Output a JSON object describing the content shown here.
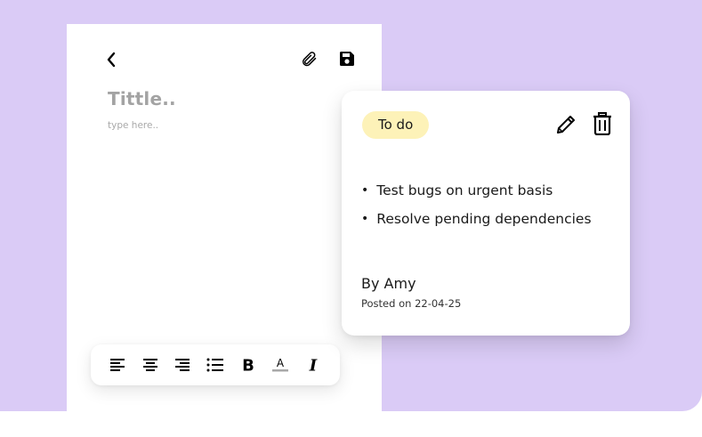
{
  "colors": {
    "backdrop": "#dacbf6",
    "badge_bg": "#fdf2b8",
    "placeholder": "#a3a3a3"
  },
  "editor": {
    "title_placeholder": "Tittle..",
    "body_placeholder": "type here..",
    "icons": {
      "back": "chevron-left-icon",
      "attach": "paperclip-icon",
      "save": "floppy-disk-icon"
    },
    "toolbar": [
      {
        "name": "align-left-icon"
      },
      {
        "name": "align-center-icon"
      },
      {
        "name": "align-right-icon"
      },
      {
        "name": "bullet-list-icon"
      },
      {
        "name": "bold-icon",
        "label": "B"
      },
      {
        "name": "text-color-icon",
        "label": "A"
      },
      {
        "name": "italic-icon",
        "label": "I"
      }
    ]
  },
  "note_card": {
    "status": "To do",
    "items": [
      "Test bugs on urgent basis",
      "Resolve pending dependencies"
    ],
    "author": "By Amy",
    "posted": "Posted on 22-04-25",
    "icons": {
      "edit": "pencil-icon",
      "delete": "trash-icon"
    }
  }
}
